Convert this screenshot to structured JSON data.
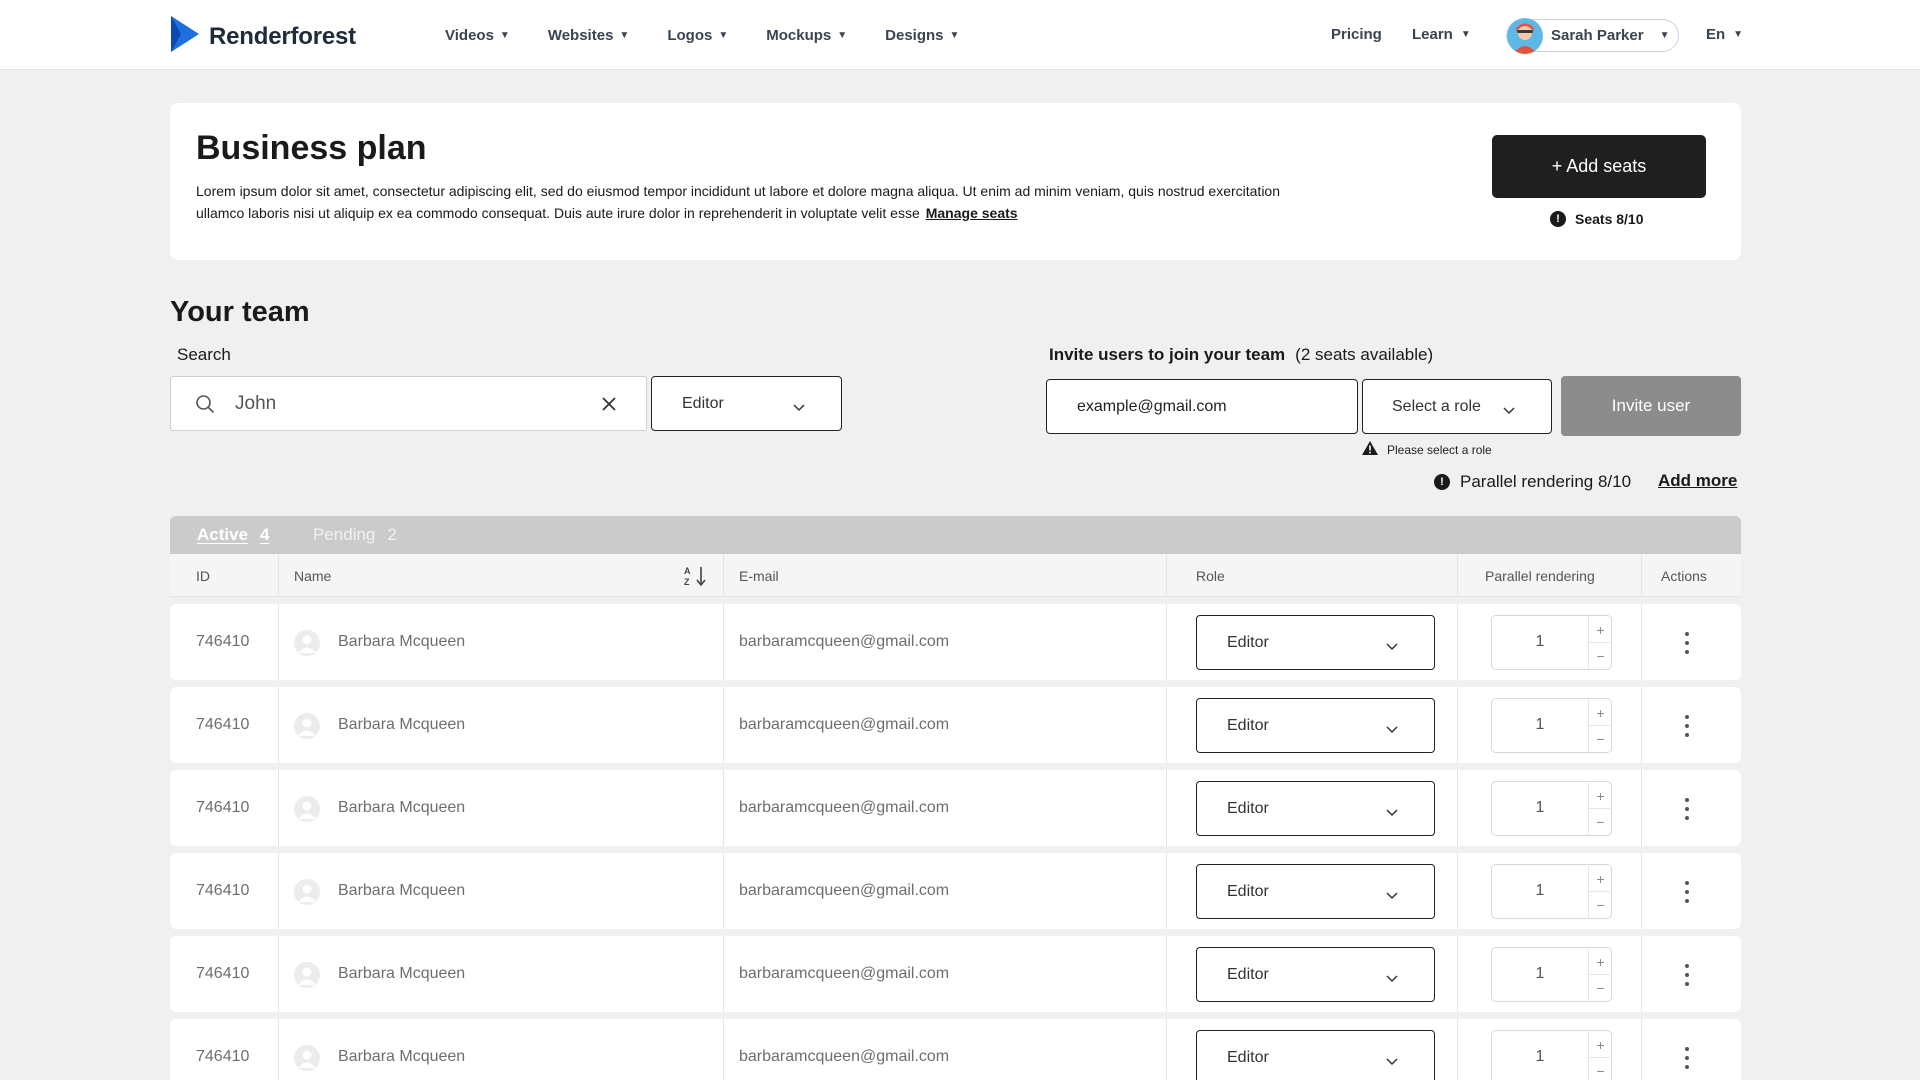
{
  "header": {
    "brand": "Renderforest",
    "nav": [
      {
        "label": "Videos"
      },
      {
        "label": "Websites"
      },
      {
        "label": "Logos"
      },
      {
        "label": "Mockups"
      },
      {
        "label": "Designs"
      }
    ],
    "pricing": "Pricing",
    "learn": "Learn",
    "user_name": "Sarah Parker",
    "language": "En"
  },
  "plan": {
    "title": "Business plan",
    "description": "Lorem ipsum dolor sit amet, consectetur adipiscing elit, sed do eiusmod tempor incididunt ut labore et dolore magna aliqua. Ut enim ad minim veniam, quis nostrud exercitation ullamco laboris nisi ut aliquip ex ea commodo consequat. Duis aute irure dolor in reprehenderit in voluptate velit esse",
    "manage_seats": "Manage seats",
    "add_seats_label": "+ Add seats",
    "seats_info": "Seats 8/10",
    "info_glyph": "!"
  },
  "team": {
    "title": "Your team",
    "search_label": "Search",
    "search_value": "John",
    "role_filter": "Editor",
    "invite_title": "Invite users to join your team",
    "invite_seats": "(2 seats available)",
    "invite_email_value": "example@gmail.com",
    "invite_role_placeholder": "Select a role",
    "invite_button": "Invite user",
    "role_warning": "Please select a role",
    "parallel_info": "Parallel rendering 8/10",
    "add_more": "Add more"
  },
  "tabs": [
    {
      "label": "Active",
      "count": "4"
    },
    {
      "label": "Pending",
      "count": "2"
    }
  ],
  "columns": [
    "ID",
    "Name",
    "E-mail",
    "Role",
    "Parallel rendering",
    "Actions"
  ],
  "rows": [
    {
      "id": "746410",
      "name": "Barbara Mcqueen",
      "email": "barbaramcqueen@gmail.com",
      "role": "Editor",
      "parallel": "1"
    },
    {
      "id": "746410",
      "name": "Barbara Mcqueen",
      "email": "barbaramcqueen@gmail.com",
      "role": "Editor",
      "parallel": "1"
    },
    {
      "id": "746410",
      "name": "Barbara Mcqueen",
      "email": "barbaramcqueen@gmail.com",
      "role": "Editor",
      "parallel": "1"
    },
    {
      "id": "746410",
      "name": "Barbara Mcqueen",
      "email": "barbaramcqueen@gmail.com",
      "role": "Editor",
      "parallel": "1"
    },
    {
      "id": "746410",
      "name": "Barbara Mcqueen",
      "email": "barbaramcqueen@gmail.com",
      "role": "Editor",
      "parallel": "1"
    },
    {
      "id": "746410",
      "name": "Barbara Mcqueen",
      "email": "barbaramcqueen@gmail.com",
      "role": "Editor",
      "parallel": "1"
    }
  ],
  "stepper": {
    "plus": "+",
    "minus": "−"
  },
  "colors": {
    "brand_blue": "#1e6fe0",
    "dark_button": "#1f1f1f",
    "disabled_button": "#8c8c8c"
  },
  "icons": [
    "play-logo-icon",
    "caret-down-icon",
    "search-icon",
    "close-icon",
    "chevron-down-icon",
    "info-icon",
    "warning-icon",
    "sort-icon",
    "user-avatar-icon",
    "kebab-menu-icon"
  ]
}
